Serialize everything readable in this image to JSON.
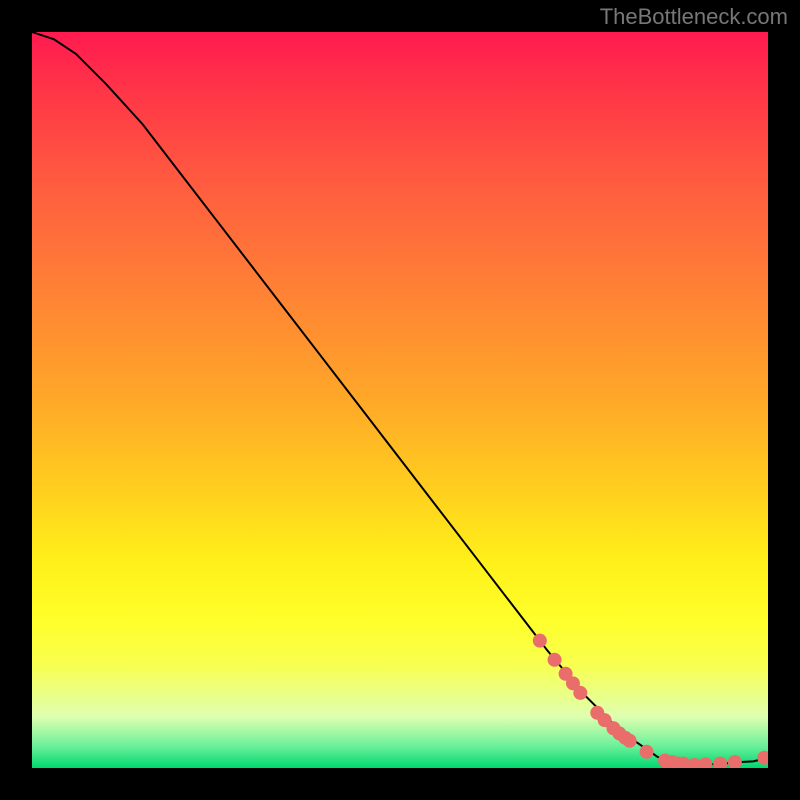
{
  "watermark": "TheBottleneck.com",
  "chart_data": {
    "type": "line",
    "title": "",
    "xlabel": "",
    "ylabel": "",
    "xlim": [
      0,
      100
    ],
    "ylim": [
      0,
      100
    ],
    "series": [
      {
        "name": "curve",
        "x": [
          0,
          3,
          6,
          10,
          15,
          20,
          25,
          30,
          35,
          40,
          45,
          50,
          55,
          60,
          65,
          70,
          75,
          80,
          85,
          88,
          90,
          92,
          94,
          96,
          98,
          100
        ],
        "y": [
          100,
          99,
          97,
          93,
          87.5,
          81,
          74.5,
          68,
          61.5,
          55,
          48.5,
          42,
          35.5,
          29,
          22.5,
          16,
          10,
          5,
          1.5,
          0.6,
          0.4,
          0.5,
          0.6,
          0.8,
          0.9,
          1.4
        ]
      }
    ],
    "markers": {
      "name": "highlight-points",
      "color": "#e96d6a",
      "x": [
        69,
        71,
        72.5,
        73.5,
        74.5,
        76.8,
        77.8,
        79,
        79.8,
        80.6,
        81.2,
        83.5,
        86,
        87,
        87.8,
        88.5,
        90,
        91.5,
        93.5,
        95.5,
        99.5
      ],
      "y": [
        17.3,
        14.7,
        12.8,
        11.5,
        10.2,
        7.5,
        6.5,
        5.4,
        4.7,
        4.1,
        3.7,
        2.2,
        1.0,
        0.8,
        0.6,
        0.6,
        0.4,
        0.5,
        0.6,
        0.8,
        1.4
      ]
    }
  }
}
